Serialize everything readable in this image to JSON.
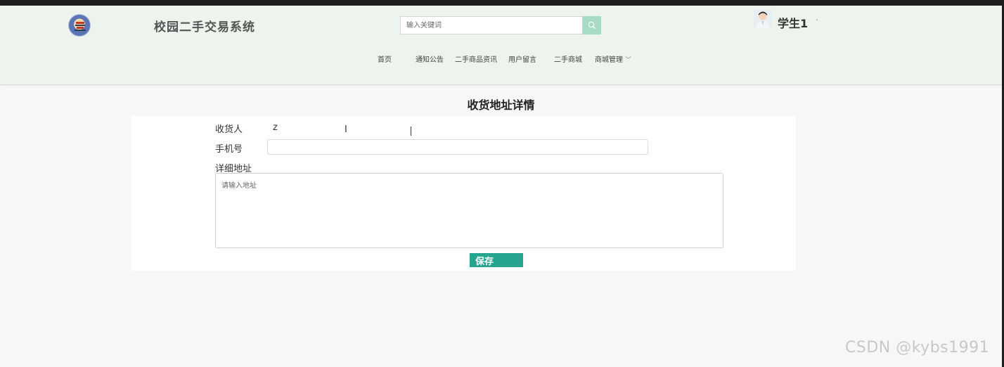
{
  "header": {
    "site_title": "校园二手交易系统",
    "logo_icon": "temple-logo-icon",
    "search": {
      "placeholder": "输入关键词",
      "icon": "search-icon"
    },
    "user": {
      "name": "学生1",
      "caret": "·"
    }
  },
  "nav": {
    "items": [
      {
        "label": "首页"
      },
      {
        "label": "通知公告"
      },
      {
        "label": "二手商品资讯"
      },
      {
        "label": "用户留言"
      },
      {
        "label": "二手商城"
      },
      {
        "label": "商城管理",
        "has_dropdown": true,
        "caret": "﹀"
      }
    ]
  },
  "page": {
    "title": "收货地址详情"
  },
  "form": {
    "receiver_label": "收货人",
    "receiver_value": "z",
    "phone_label": "手机号",
    "phone_value": "",
    "address_label": "详细地址",
    "address_placeholder": "请输入地址",
    "save_label": "保存"
  },
  "watermark": "CSDN @kybs1991",
  "colors": {
    "accent": "#26a48f",
    "search_button": "#a5dcc3",
    "header_bg": "#edf4ed"
  }
}
